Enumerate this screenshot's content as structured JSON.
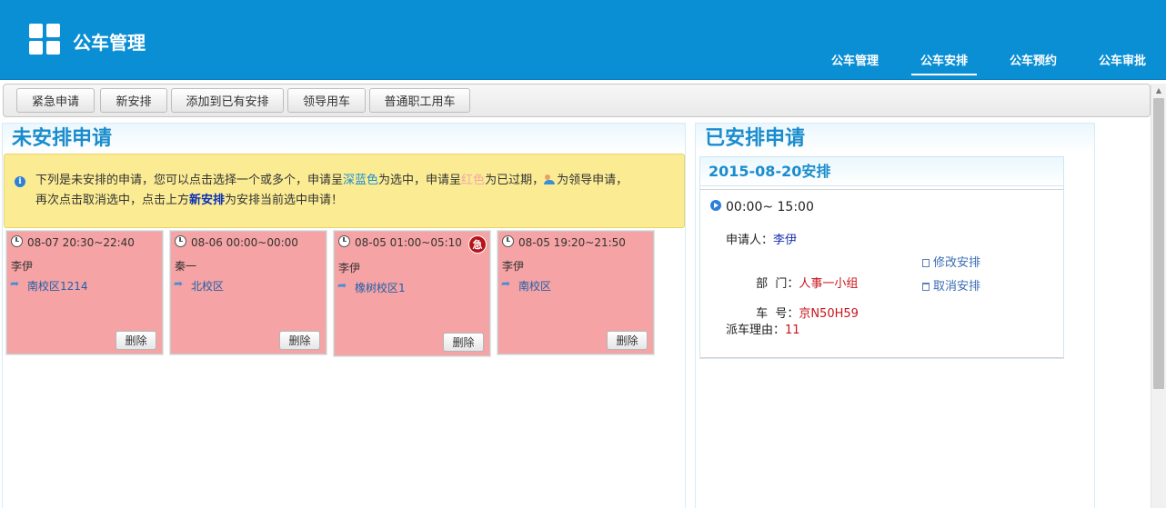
{
  "app": {
    "title": "公车管理"
  },
  "nav": [
    {
      "label": "公车管理",
      "active": false
    },
    {
      "label": "公车安排",
      "active": true
    },
    {
      "label": "公车预约",
      "active": false
    },
    {
      "label": "公车审批",
      "active": false
    }
  ],
  "toolbar": {
    "urgent_label": "紧急申请",
    "new_label": "新安排",
    "add_existing_label": "添加到已有安排",
    "leader_label": "领导用车",
    "staff_label": "普通职工用车"
  },
  "unassigned": {
    "title": "未安排申请",
    "notice": {
      "part1": "下列是未安排的申请，您可以点击选择一个或多个，申请呈",
      "blue": "深蓝色",
      "part2": "为选中，申请呈",
      "red": "红色",
      "part3": "为已过期，",
      "part4": "为领导申请，",
      "part5": "再次点击取消选中，点击上方",
      "bold": "新安排",
      "part6": "为安排当前选中申请！"
    },
    "cards": [
      {
        "time": "08-07 20:30~22:40",
        "person": "李伊",
        "place": "南校区1214",
        "delete": "删除",
        "urgent": ""
      },
      {
        "time": "08-06 00:00~00:00",
        "person": "秦一",
        "place": "北校区",
        "delete": "删除",
        "urgent": ""
      },
      {
        "time": "08-05 01:00~05:10",
        "person": "李伊",
        "place": "橡树校区1",
        "delete": "删除",
        "urgent": "急"
      },
      {
        "time": "08-05 19:20~21:50",
        "person": "李伊",
        "place": "南校区",
        "delete": "删除",
        "urgent": ""
      }
    ]
  },
  "assigned": {
    "title": "已安排申请",
    "date_header": "2015-08-20安排",
    "slot_time": "00:00~ 15:00",
    "applicant_label": "申请人：",
    "applicant": "李伊",
    "dept_label": "部  门：",
    "dept": "人事一小组",
    "car_label": "车  号：",
    "car": "京N50H59",
    "reason_label": "派车理由：",
    "reason": "11",
    "edit_label": "修改安排",
    "cancel_label": "取消安排"
  },
  "colors": {
    "header_blue": "#0b8fd4",
    "card_pink": "#f5a3a4",
    "notice_yellow": "#fbec94",
    "title_blue": "#1a8ccd",
    "urgent_red": "#b8131a"
  }
}
